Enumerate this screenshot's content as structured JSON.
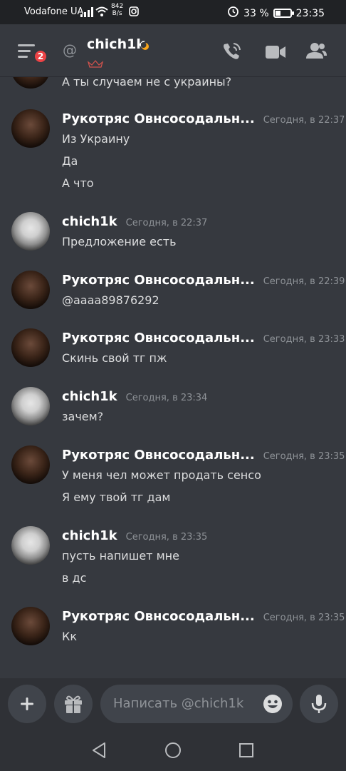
{
  "statusbar": {
    "carrier": "Vodafone UA",
    "speed_value": "842",
    "speed_unit": "B/s",
    "battery": "33 %",
    "battery_level": 0.33,
    "time": "23:35"
  },
  "header": {
    "at_symbol": "@",
    "title": "chich1k",
    "unread_badge": "2",
    "icons": [
      "menu-icon",
      "moon-icon",
      "crown-icon",
      "call-icon",
      "video-icon",
      "members-icon"
    ]
  },
  "messages": [
    {
      "type": "partial",
      "lines": [
        "А ты случаем не с украины?"
      ]
    },
    {
      "author": "Рукотряс Овнсосодальн...",
      "timestamp": "Сегодня, в 22:37",
      "avatar": "dark",
      "lines": [
        "Из Украину",
        "Да",
        "А что"
      ]
    },
    {
      "author": "chich1k",
      "timestamp": "Сегодня, в 22:37",
      "avatar": "light",
      "lines": [
        "Предложение есть"
      ]
    },
    {
      "author": "Рукотряс Овнсосодальн...",
      "timestamp": "Сегодня, в 22:39",
      "avatar": "dark",
      "lines": [
        "@aaaa89876292"
      ]
    },
    {
      "author": "Рукотряс Овнсосодальн...",
      "timestamp": "Сегодня, в 23:33",
      "avatar": "dark",
      "lines": [
        "Скинь свой тг пж"
      ]
    },
    {
      "author": "chich1k",
      "timestamp": "Сегодня, в 23:34",
      "avatar": "light",
      "lines": [
        "зачем?"
      ]
    },
    {
      "author": "Рукотряс Овнсосодальн...",
      "timestamp": "Сегодня, в 23:35",
      "avatar": "dark",
      "lines": [
        "У меня чел может продать сенсо",
        "Я ему твой тг дам"
      ]
    },
    {
      "author": "chich1k",
      "timestamp": "Сегодня, в 23:35",
      "avatar": "light",
      "lines": [
        "пусть напишет мне",
        "в дс"
      ]
    },
    {
      "author": "Рукотряс Овнсосодальн...",
      "timestamp": "Сегодня, в 23:35",
      "avatar": "dark",
      "lines": [
        "Кк"
      ]
    }
  ],
  "composer": {
    "placeholder": "Написать @chich1k",
    "icons": [
      "plus-icon",
      "gift-icon",
      "emoji-icon",
      "mic-icon"
    ]
  },
  "navbar": {
    "icons": [
      "back-icon",
      "home-icon",
      "recents-icon"
    ]
  },
  "colors": {
    "background": "#36393f",
    "header_bg": "#36393f",
    "statusbar_bg": "#202225",
    "composer_bg": "#2f3136",
    "input_bg": "#40444b",
    "badge": "#ed4245",
    "moon": "#faa61a",
    "timestamp": "#8e9297",
    "text": "#dcddde"
  }
}
